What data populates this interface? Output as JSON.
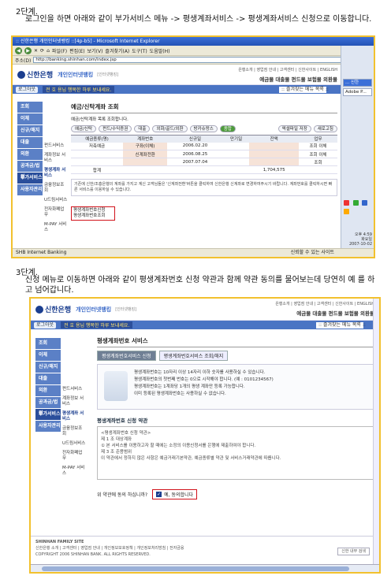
{
  "step2": {
    "heading": "2단계.",
    "text": "로그인을 하면 아래와 같이 부가서비스 메뉴 -> 평생계좌서비스 -> 평생계좌서비스 신청으로 이동합니다."
  },
  "step3": {
    "heading": "3단계.",
    "text": "신청 메뉴로 이동하면 아래와 같이 평생계좌번호 신청 약관과 함께 약관 동의를 물어보는데 당연히 예 를 하고 넘어갑니다."
  },
  "browser": {
    "title": ":: 신한은행 개인인터넷뱅킹 ::[4p-b5] - Microsoft Internet Explorer",
    "menu": [
      "파일(F)",
      "편집(E)",
      "보기(V)",
      "즐겨찾기(A)",
      "도구(T)",
      "도움말(H)"
    ],
    "address_label": "주소(D)",
    "address": "http://banking.shinhan.com/index.jsp",
    "status_left": "SHB Internet Banking",
    "status_right": "신뢰할 수 있는 사이트",
    "taskbar_items": [
      "... 신한",
      "Adobe P..."
    ],
    "clock_time": "오후 4:59",
    "clock_day": "화요일",
    "clock_date": "2007-10-02"
  },
  "bank": {
    "logo": "신한은행",
    "sub": "개인인터넷뱅킹",
    "mini": "[인터넷뱅킹]",
    "head_links": "은행소개 | 영업점 안내 | 고객센터 | 신한사이트 | ENGLISH",
    "head_menu": "예금몰  대출몰  펀드몰  보험몰  외환몰",
    "logout": "로그아웃",
    "slogan": "전 호 용님 행복한 하루 보내세요.",
    "menu_select": ":: 즐겨찾는 메뉴 목록 ::",
    "left_nav": [
      "조회",
      "이체",
      "신규/해지",
      "대출",
      "외환",
      "공과금/법원",
      "부가서비스",
      "사용자관리"
    ],
    "sub_nav": [
      "펀드서비스",
      "계좌정보 서비스",
      "평생계좌 서비스",
      "금융정보조회",
      "U드림서비스",
      "전자화폐업무",
      "M-PAY 서비스"
    ],
    "popup": [
      "평생계좌번호신청",
      "평생계좌번호조회"
    ]
  },
  "shot1": {
    "section_title": "예금/신탁계좌 조회",
    "notice_line": "예금/신탁계좌 목록 조회합니다.",
    "tabs": [
      "예금/신탁",
      "펀드/수익증권",
      "대출",
      "외화/골드/외환",
      "방카슈랑스",
      "종합"
    ],
    "table_headers": [
      "예금종류(명)",
      "계좌번호",
      "신규일",
      "만기일",
      "잔액",
      "업무"
    ],
    "rows": [
      {
        "type": "저축예금",
        "extra": "구좌(이체)",
        "date": "2006.02.20",
        "action": "조회 이체"
      },
      {
        "type": "",
        "extra": "신계좌전환",
        "date": "2006.08.25",
        "action": "조회 이체"
      },
      {
        "type": "",
        "extra": "",
        "date": "2007.07.04",
        "action": "조회"
      }
    ],
    "total_label": "합계",
    "total_value": "1,704,575",
    "excel": "엑셀파일 저장",
    "refresh": "새로고침",
    "notice": "기존에 신한/조흥은행의 계좌를 가지고 계신 고객님들은 '신계좌전환'버튼을 클릭하여 신한은행 신계좌로 변경하여주시기 바랍니다. 계좌번호를 클릭하시면 빠른 서비스를 이용하실 수 있습니다."
  },
  "shot2": {
    "section_title": "평생계좌번호 서비스",
    "tab_on": "평생계좌번호서비스 신청",
    "tab_off": "평생계좌번호서비스 조회/해지",
    "info": [
      "평생계좌번호는 10자리 이상 14자리 이하 숫자를 사용하실 수 있습니다.",
      "평생계좌번호의 첫번째 번호는 0으로 시작해야 합니다. (예 : 0101234567)",
      "평생계좌번호는 1계좌당 1개의 평생 계좌만 등록 가능합니다.",
      "이미 등록된 평생계좌번호는 사용하실 수 없습니다."
    ],
    "terms_title": "평생계좌번호 신청 약관",
    "terms": [
      "<평생계좌번호 신청 약관>",
      "제 1 조 대상계좌",
      "① 본 서비스를 이용하고자 할 때에는 소정의 이용신청서를 은행에 제출하여야 합니다.",
      "제 3 조 준용범위",
      "이 약관에서 정하지 않은 사항은 예금거래기본약관, 예금종류별 약관 및 서비스거래약관에 따릅니다."
    ],
    "agree_question": "위 약관에 동의 하십니까?",
    "agree_label": "예, 동의합니다",
    "footer_family": "SHINHAN FAMILY SITE",
    "footer_links": "신한은행 소개 | 고객센터 | 영업점 안내 | 개인정보보호정책 | 개인정보처리방침 | 전자금융",
    "footer_copy": "COPYRIGHT 2006 SHINHAN BANK. ALL RIGHTS RESERVED.",
    "footer_search": "신한 내부 검색"
  }
}
